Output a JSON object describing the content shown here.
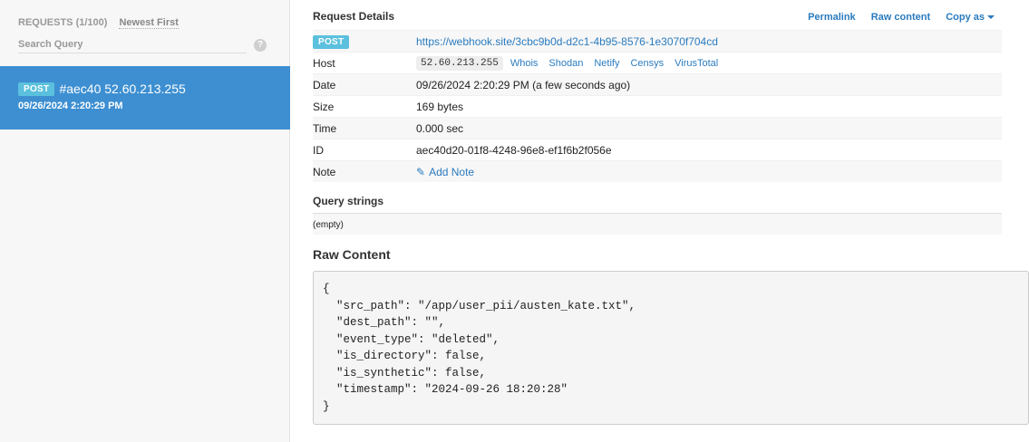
{
  "sidebar": {
    "requests_count": "REQUESTS (1/100)",
    "sort_label": "Newest First",
    "search_placeholder": "Search Query",
    "help_glyph": "?",
    "items": [
      {
        "method": "POST",
        "title": "#aec40 52.60.213.255",
        "datetime": "09/26/2024 2:20:29 PM"
      }
    ]
  },
  "details": {
    "title": "Request Details",
    "links": {
      "permalink": "Permalink",
      "raw_content": "Raw content",
      "copy_as": "Copy as"
    },
    "method": "POST",
    "url": "https://webhook.site/3cbc9b0d-d2c1-4b95-8576-1e3070f704cd",
    "host_label": "Host",
    "host_ip": "52.60.213.255",
    "host_links": [
      "Whois",
      "Shodan",
      "Netify",
      "Censys",
      "VirusTotal"
    ],
    "date_label": "Date",
    "date_value": "09/26/2024 2:20:29 PM (a few seconds ago)",
    "size_label": "Size",
    "size_value": "169 bytes",
    "time_label": "Time",
    "time_value": "0.000 sec",
    "id_label": "ID",
    "id_value": "aec40d20-01f8-4248-96e8-ef1f6b2f056e",
    "note_label": "Note",
    "add_note": "Add Note"
  },
  "query_strings": {
    "title": "Query strings",
    "value": "(empty)"
  },
  "raw_content": {
    "title": "Raw Content",
    "body": "{\n  \"src_path\": \"/app/user_pii/austen_kate.txt\",\n  \"dest_path\": \"\",\n  \"event_type\": \"deleted\",\n  \"is_directory\": false,\n  \"is_synthetic\": false,\n  \"timestamp\": \"2024-09-26 18:20:28\"\n}"
  },
  "colors": {
    "accent": "#3d8fd1",
    "badge": "#5bc0de",
    "link": "#2a7bbf"
  }
}
